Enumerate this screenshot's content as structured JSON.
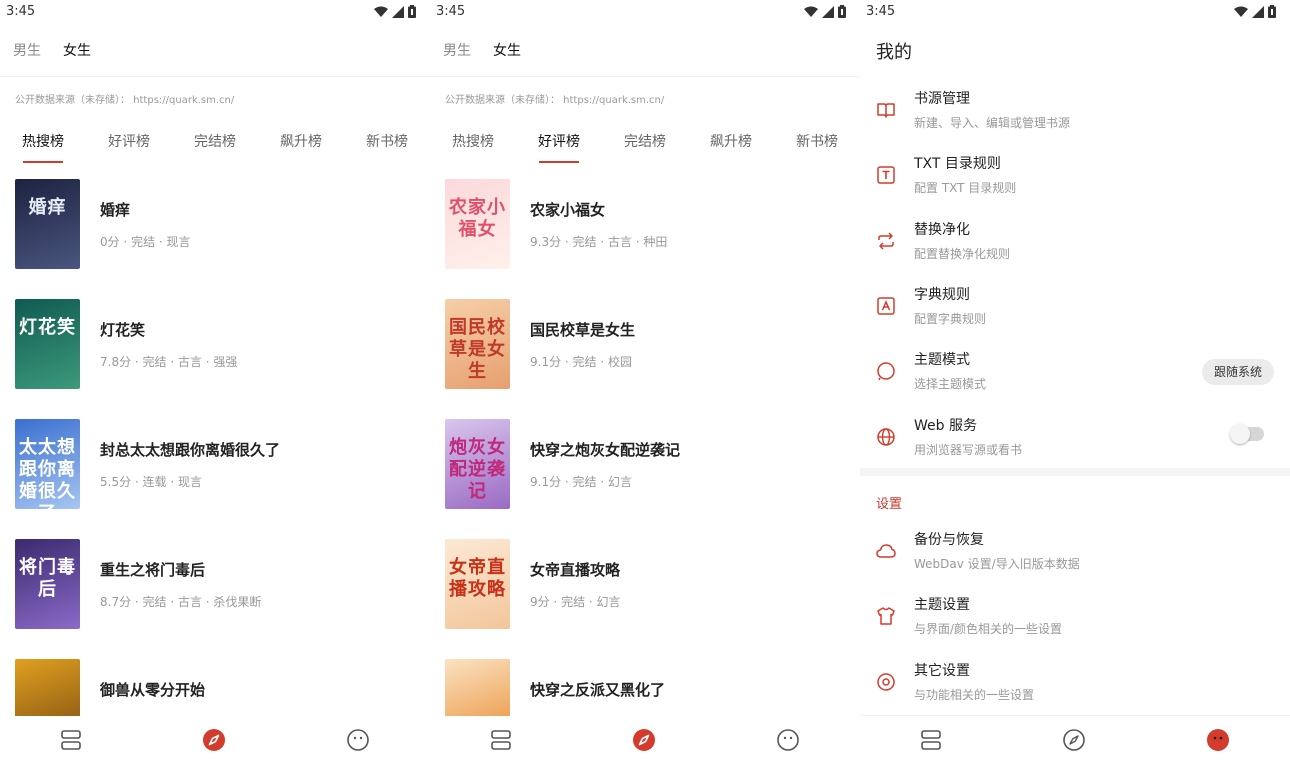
{
  "colors": {
    "accent": "#d33b2c",
    "text": "#222222",
    "muted": "#999999"
  },
  "status_time": "3:45",
  "discover": {
    "genders": [
      "男生",
      "女生"
    ],
    "source_note": "公开数据来源（未存储）： https://quark.sm.cn/",
    "tabs": [
      "热搜榜",
      "好评榜",
      "完结榜",
      "飙升榜",
      "新书榜"
    ]
  },
  "panel1": {
    "active_tab_index": 0,
    "books": [
      {
        "title": "婚痒",
        "meta": "0分 · 完结 · 现言",
        "cover_text": "婚痒",
        "cover_colors": [
          "#1c2340",
          "#4a5680"
        ],
        "cover_text_color": "#e8ecf5"
      },
      {
        "title": "灯花笑",
        "meta": "7.8分 · 完结 · 古言 · 强强",
        "cover_text": "灯花笑",
        "cover_colors": [
          "#0f5a52",
          "#3d9a7a"
        ],
        "cover_text_color": "#ffffff"
      },
      {
        "title": "封总太太想跟你离婚很久了",
        "meta": "5.5分 · 连载 · 现言",
        "cover_text": "太太想跟你离婚很久了",
        "cover_colors": [
          "#3a6fd0",
          "#a6c6f2"
        ],
        "cover_text_color": "#ffffff"
      },
      {
        "title": "重生之将门毒后",
        "meta": "8.7分 · 完结 · 古言 · 杀伐果断",
        "cover_text": "将门毒后",
        "cover_colors": [
          "#3b2a6e",
          "#8a6ac8"
        ],
        "cover_text_color": "#ffffff"
      },
      {
        "title": "御兽从零分开始",
        "meta": "",
        "cover_text": "",
        "cover_colors": [
          "#e0a020",
          "#7a4a10"
        ],
        "cover_text_color": "#ffffff"
      }
    ]
  },
  "panel2": {
    "active_tab_index": 1,
    "books": [
      {
        "title": "农家小福女",
        "meta": "9.3分 · 完结 · 古言 · 种田",
        "cover_text": "农家小福女",
        "cover_colors": [
          "#fbd9dc",
          "#fff0ea"
        ],
        "cover_text_color": "#e0506a"
      },
      {
        "title": "国民校草是女生",
        "meta": "9.1分 · 完结 · 校园",
        "cover_text": "国民校草是女生",
        "cover_colors": [
          "#f6cfa8",
          "#e6a070"
        ],
        "cover_text_color": "#c0392b"
      },
      {
        "title": "快穿之炮灰女配逆袭记",
        "meta": "9.1分 · 完结 · 幻言",
        "cover_text": "炮灰女配逆袭记",
        "cover_colors": [
          "#d9c6ec",
          "#9a6ac4"
        ],
        "cover_text_color": "#c0287a"
      },
      {
        "title": "女帝直播攻略",
        "meta": "9分 · 完结 · 幻言",
        "cover_text": "女帝直播攻略",
        "cover_colors": [
          "#fbe9d6",
          "#f3c69a"
        ],
        "cover_text_color": "#c83018"
      },
      {
        "title": "快穿之反派又黑化了",
        "meta": "",
        "cover_text": "",
        "cover_colors": [
          "#fbe3c2",
          "#e88a30"
        ],
        "cover_text_color": "#c83018"
      }
    ]
  },
  "mine": {
    "title": "我的",
    "items": [
      {
        "icon": "book-icon",
        "title": "书源管理",
        "sub": "新建、导入、编辑或管理书源"
      },
      {
        "icon": "txt-icon",
        "title": "TXT 目录规则",
        "sub": "配置 TXT 目录规则"
      },
      {
        "icon": "replace-icon",
        "title": "替换净化",
        "sub": "配置替换净化规则"
      },
      {
        "icon": "dictionary-icon",
        "title": "字典规则",
        "sub": "配置字典规则"
      },
      {
        "icon": "theme-mode-icon",
        "title": "主题模式",
        "sub": "选择主题模式",
        "pill": "跟随系统"
      },
      {
        "icon": "globe-icon",
        "title": "Web 服务",
        "sub": "用浏览器写源或看书",
        "toggle_on": false
      }
    ],
    "section_title": "设置",
    "settings": [
      {
        "icon": "cloud-icon",
        "title": "备份与恢复",
        "sub": "WebDav 设置/导入旧版本数据"
      },
      {
        "icon": "shirt-icon",
        "title": "主题设置",
        "sub": "与界面/颜色相关的一些设置"
      },
      {
        "icon": "settings-icon",
        "title": "其它设置",
        "sub": "与功能相关的一些设置"
      }
    ]
  },
  "nav": {
    "items": [
      "bookshelf-icon",
      "explore-icon",
      "my-icon"
    ]
  }
}
